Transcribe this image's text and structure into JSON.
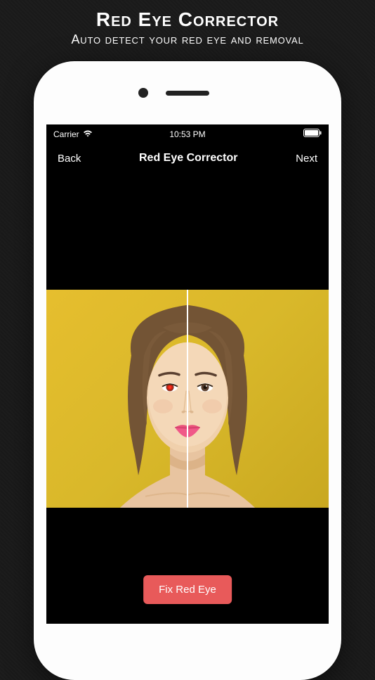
{
  "promo": {
    "title": "Red Eye Corrector",
    "subtitle": "Auto detect your red eye and removal"
  },
  "statusBar": {
    "carrier": "Carrier",
    "time": "10:53 PM"
  },
  "navBar": {
    "back": "Back",
    "title": "Red Eye Corrector",
    "next": "Next"
  },
  "actions": {
    "fixButton": "Fix Red Eye"
  },
  "colors": {
    "accent": "#e85a5a",
    "background": "#000000",
    "photoBg": "#d9b82a"
  }
}
